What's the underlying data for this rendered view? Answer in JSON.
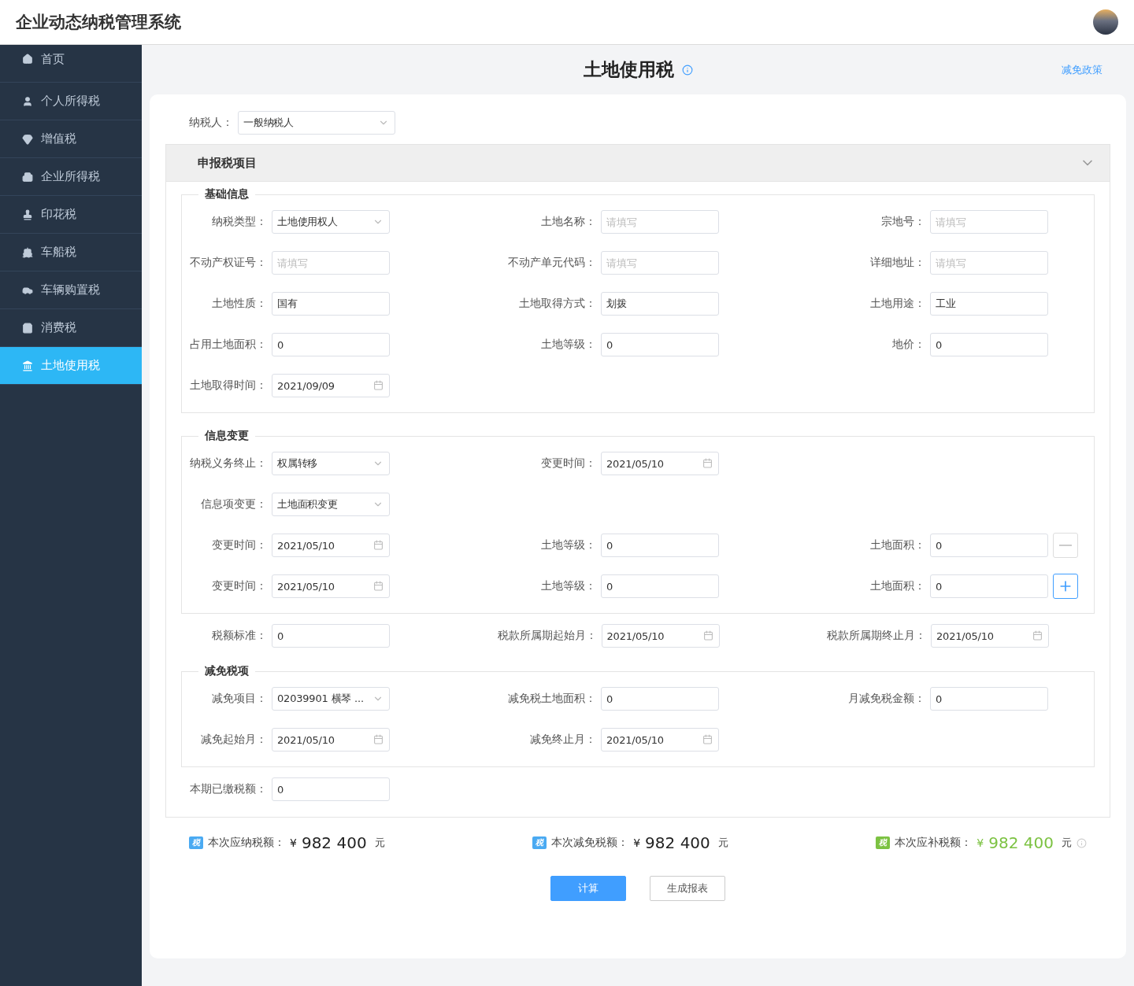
{
  "header": {
    "title": "企业动态纳税管理系统"
  },
  "sidebar": {
    "items": [
      {
        "label": "首页",
        "selected": false
      },
      {
        "label": "个人所得税",
        "selected": false
      },
      {
        "label": "增值税",
        "selected": false
      },
      {
        "label": "企业所得税",
        "selected": false
      },
      {
        "label": "印花税",
        "selected": false
      },
      {
        "label": "车船税",
        "selected": false
      },
      {
        "label": "车辆购置税",
        "selected": false
      },
      {
        "label": "消费税",
        "selected": false
      },
      {
        "label": "土地使用税",
        "selected": true
      }
    ]
  },
  "page": {
    "title": "土地使用税",
    "link": "减免政策"
  },
  "taxpayer": {
    "label": "纳税人：",
    "value": "一般纳税人"
  },
  "panel": {
    "title": "申报税项目",
    "expanded": true
  },
  "sections": [
    {
      "kind": "fieldset",
      "title": "基础信息",
      "rows": [
        {
          "fields": [
            {
              "label": "纳税类型：",
              "kind": "select",
              "value": "土地使用权人"
            },
            {
              "label": "土地名称：",
              "kind": "text",
              "placeholder": "请填写"
            },
            {
              "label": "宗地号：",
              "kind": "text",
              "placeholder": "请填写"
            }
          ]
        },
        {
          "fields": [
            {
              "label": "不动产权证号：",
              "kind": "text",
              "placeholder": "请填写"
            },
            {
              "label": "不动产单元代码：",
              "kind": "text",
              "placeholder": "请填写"
            },
            {
              "label": "详细地址：",
              "kind": "text",
              "placeholder": "请填写"
            }
          ]
        },
        {
          "fields": [
            {
              "label": "土地性质：",
              "kind": "text",
              "value": "国有"
            },
            {
              "label": "土地取得方式：",
              "kind": "text",
              "value": "划拨"
            },
            {
              "label": "土地用途：",
              "kind": "text",
              "value": "工业"
            }
          ]
        },
        {
          "fields": [
            {
              "label": "占用土地面积：",
              "kind": "text",
              "value": "0"
            },
            {
              "label": "土地等级：",
              "kind": "text",
              "value": "0"
            },
            {
              "label": "地价：",
              "kind": "text",
              "value": "0"
            }
          ]
        },
        {
          "fields": [
            {
              "label": "土地取得时间：",
              "kind": "date",
              "value": "2021/09/09"
            }
          ]
        }
      ]
    },
    {
      "kind": "fieldset",
      "title": "信息变更",
      "rows": [
        {
          "fields": [
            {
              "label": "纳税义务终止：",
              "kind": "select",
              "value": "权属转移"
            },
            {
              "label": "变更时间：",
              "kind": "date",
              "value": "2021/05/10"
            }
          ]
        },
        {
          "fields": [
            {
              "label": "信息项变更：",
              "kind": "select",
              "value": "土地面积变更"
            }
          ]
        },
        {
          "fields": [
            {
              "label": "变更时间：",
              "kind": "date",
              "value": "2021/05/10"
            },
            {
              "label": "土地等级：",
              "kind": "text",
              "value": "0"
            },
            {
              "label": "土地面积：",
              "kind": "text",
              "value": "0"
            }
          ],
          "action": {
            "kind": "minus",
            "disabled": true
          }
        },
        {
          "fields": [
            {
              "label": "变更时间：",
              "kind": "date",
              "value": "2021/05/10"
            },
            {
              "label": "土地等级：",
              "kind": "text",
              "value": "0"
            },
            {
              "label": "土地面积：",
              "kind": "text",
              "value": "0"
            }
          ],
          "action": {
            "kind": "plus",
            "disabled": false
          }
        }
      ]
    },
    {
      "kind": "plain",
      "rows": [
        {
          "fields": [
            {
              "label": "税额标准：",
              "kind": "text",
              "value": "0"
            },
            {
              "label": "税款所属期起始月：",
              "kind": "date",
              "value": "2021/05/10"
            },
            {
              "label": "税款所属期终止月：",
              "kind": "date",
              "value": "2021/05/10"
            }
          ]
        }
      ]
    },
    {
      "kind": "fieldset",
      "title": "减免税项",
      "rows": [
        {
          "fields": [
            {
              "label": "减免项目：",
              "kind": "select",
              "value": "02039901 横琴 ..."
            },
            {
              "label": "减免税土地面积：",
              "kind": "text",
              "value": "0"
            },
            {
              "label": "月减免税金额：",
              "kind": "text",
              "value": "0"
            }
          ]
        },
        {
          "fields": [
            {
              "label": "减免起始月：",
              "kind": "date",
              "value": "2021/05/10"
            },
            {
              "label": "减免终止月：",
              "kind": "date",
              "value": "2021/05/10"
            }
          ]
        }
      ]
    },
    {
      "kind": "plain",
      "rows": [
        {
          "fields": [
            {
              "label": "本期已缴税额：",
              "kind": "text",
              "value": "0"
            }
          ]
        }
      ]
    }
  ],
  "totals": [
    {
      "badge": "税",
      "color": "#4aaaf2",
      "label": "本次应纳税额：",
      "currency": "¥",
      "amount": "982 400",
      "unit": "元",
      "highlight": false,
      "info": false
    },
    {
      "badge": "税",
      "color": "#4aaaf2",
      "label": "本次减免税额：",
      "currency": "¥",
      "amount": "982 400",
      "unit": "元",
      "highlight": false,
      "info": false
    },
    {
      "badge": "税",
      "color": "#7cc242",
      "label": "本次应补税额：",
      "currency": "¥",
      "amount": "982 400",
      "unit": "元",
      "highlight": true,
      "info": true
    }
  ],
  "buttons": [
    {
      "label": "计算",
      "primary": true
    },
    {
      "label": "生成报表",
      "primary": false
    }
  ]
}
